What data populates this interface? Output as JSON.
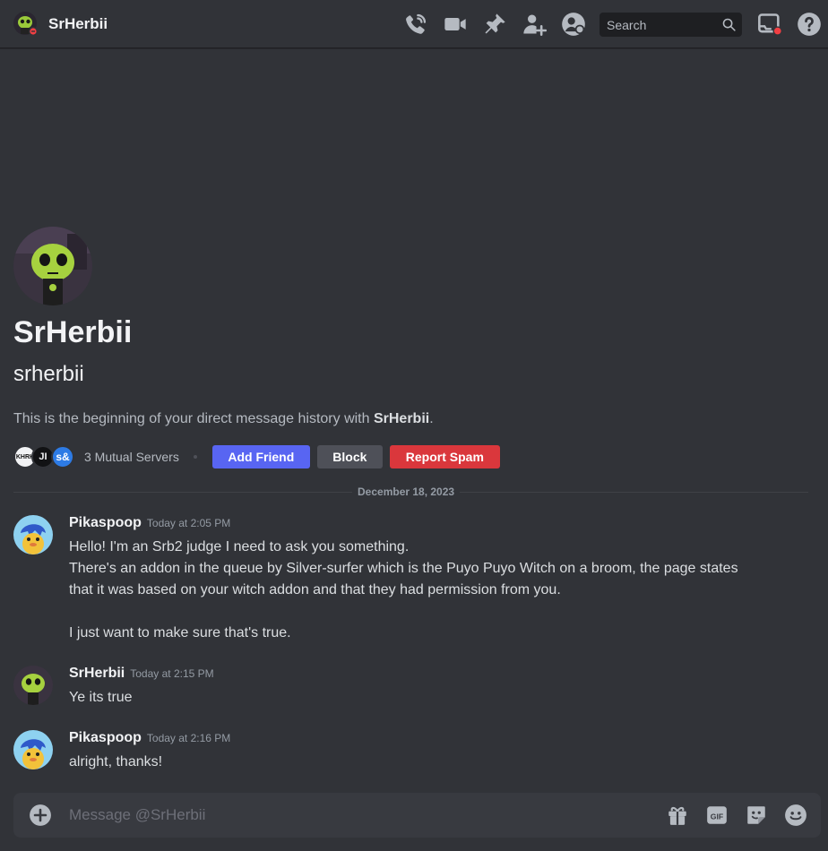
{
  "header": {
    "display_name": "SrHerbii",
    "search_placeholder": "Search"
  },
  "icons": {
    "call": "phone-call-icon",
    "video": "video-camera-icon",
    "pinned": "pin-icon",
    "add_member": "add-user-icon",
    "profile": "user-profile-icon",
    "search": "search-icon",
    "inbox": "inbox-icon",
    "help": "help-icon",
    "attach": "plus-circle-icon",
    "gift": "gift-icon",
    "gif": "gif-icon",
    "sticker": "sticker-icon",
    "emoji": "emoji-icon"
  },
  "intro": {
    "display_name": "SrHerbii",
    "username": "srherbii",
    "description_prefix": "This is the beginning of your direct message history with ",
    "description_name": "SrHerbii",
    "description_suffix": ".",
    "mutual_servers": "3 Mutual Servers",
    "server_icons": [
      "KHRK",
      "JI",
      "s&"
    ],
    "add_friend": "Add Friend",
    "block": "Block",
    "report_spam": "Report Spam"
  },
  "divider_date": "December 18, 2023",
  "messages": [
    {
      "author": "Pikaspoop",
      "time": "Today at 2:05 PM",
      "lines": [
        "Hello! I'm an Srb2 judge I need to ask you something.",
        "There's an addon in the queue by Silver-surfer which is the Puyo Puyo Witch on a broom, the page states",
        "that it was based on your witch addon and that they had permission from you.",
        "",
        "I just want to make sure that's true."
      ]
    },
    {
      "author": "SrHerbii",
      "time": "Today at 2:15 PM",
      "lines": [
        "Ye its true"
      ]
    },
    {
      "author": "Pikaspoop",
      "time": "Today at 2:16 PM",
      "lines": [
        "alright, thanks!"
      ]
    }
  ],
  "composer": {
    "placeholder": "Message @SrHerbii"
  },
  "colors": {
    "background": "#313338",
    "blurple": "#5865f2",
    "danger": "#da373c",
    "secondary": "#4e5058",
    "status_dnd": "#f23f43"
  }
}
